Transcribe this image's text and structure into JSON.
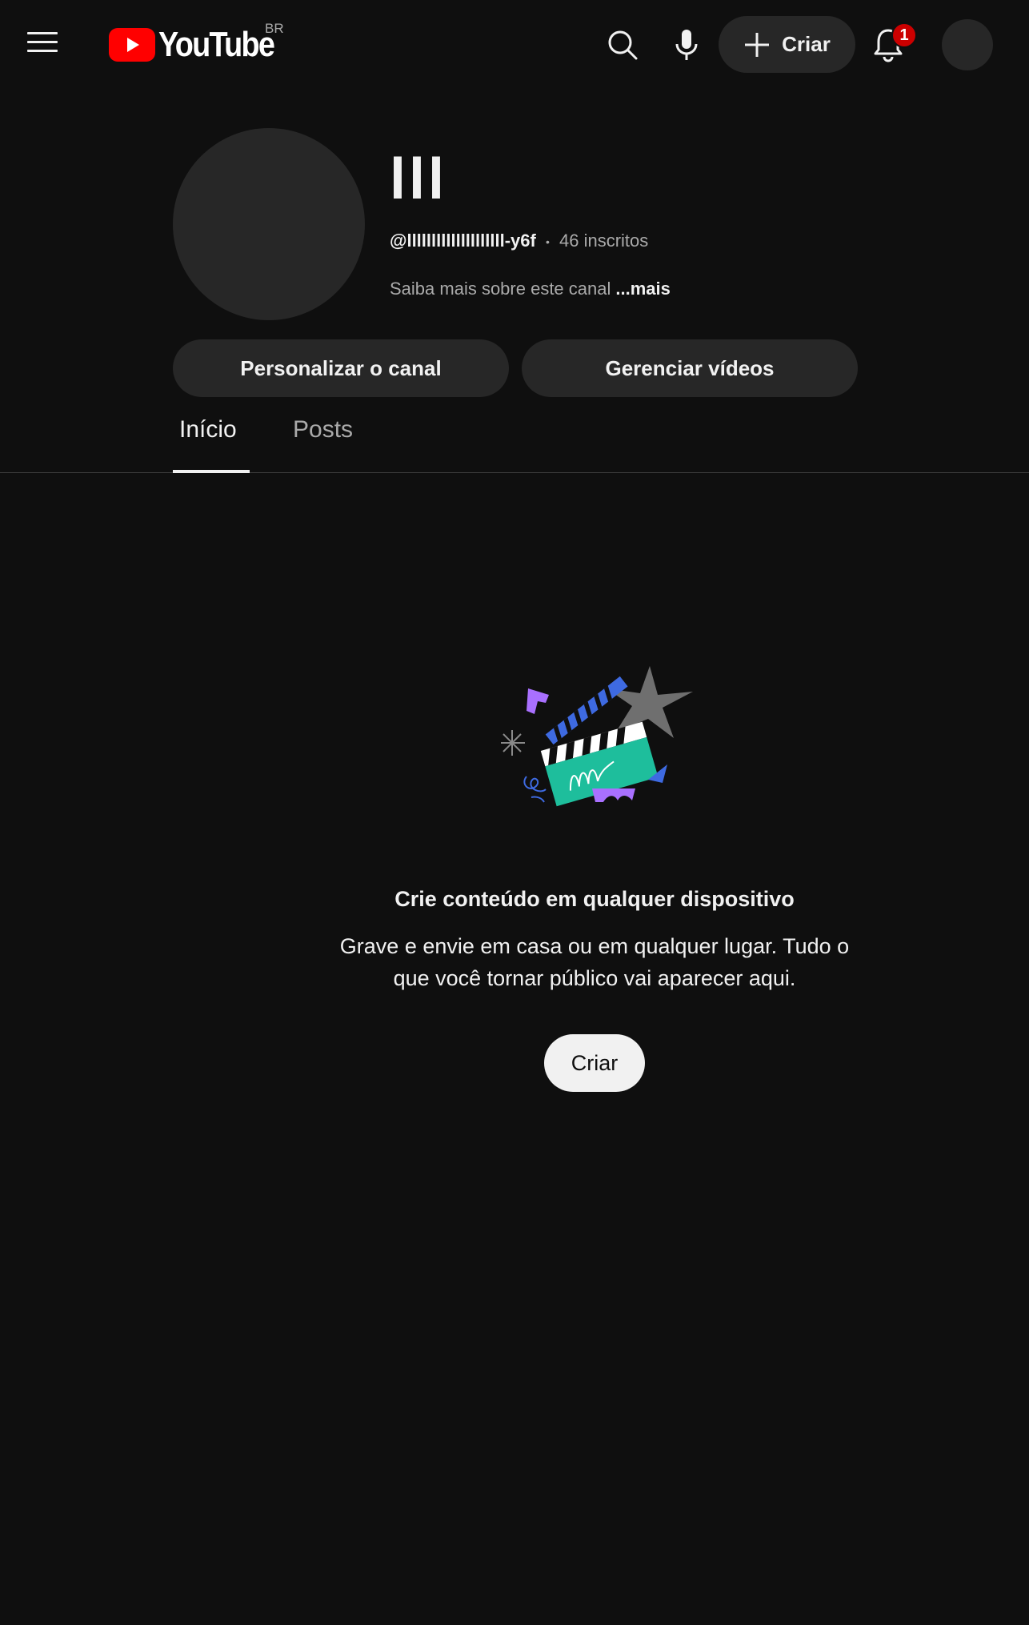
{
  "header": {
    "logo_text": "YouTube",
    "region": "BR",
    "create_label": "Criar",
    "notifications_count": "1",
    "icons": [
      "menu-icon",
      "search-icon",
      "microphone-icon",
      "plus-icon",
      "bell-icon"
    ],
    "brand_color": "#ff0000"
  },
  "channel": {
    "name": "lll",
    "handle": "@llllllllllllllllllll-y6f",
    "separator": "•",
    "subscribers": "46 inscritos",
    "about": "Saiba mais sobre este canal",
    "about_more": "...mais",
    "customize_label": "Personalizar o canal",
    "manage_label": "Gerenciar vídeos"
  },
  "tabs": [
    {
      "label": "Início",
      "active": true
    },
    {
      "label": "Posts",
      "active": false
    }
  ],
  "empty_state": {
    "title": "Crie conteúdo em qualquer dispositivo",
    "body": "Grave e envie em casa ou em qualquer lugar. Tudo o que você tornar público vai aparecer aqui.",
    "button_label": "Criar"
  },
  "colors": {
    "background": "#0f0f0f",
    "surface": "#272727",
    "text": "#f1f1f1",
    "secondary_text": "#aaaaaa",
    "badge": "#cc0000"
  }
}
